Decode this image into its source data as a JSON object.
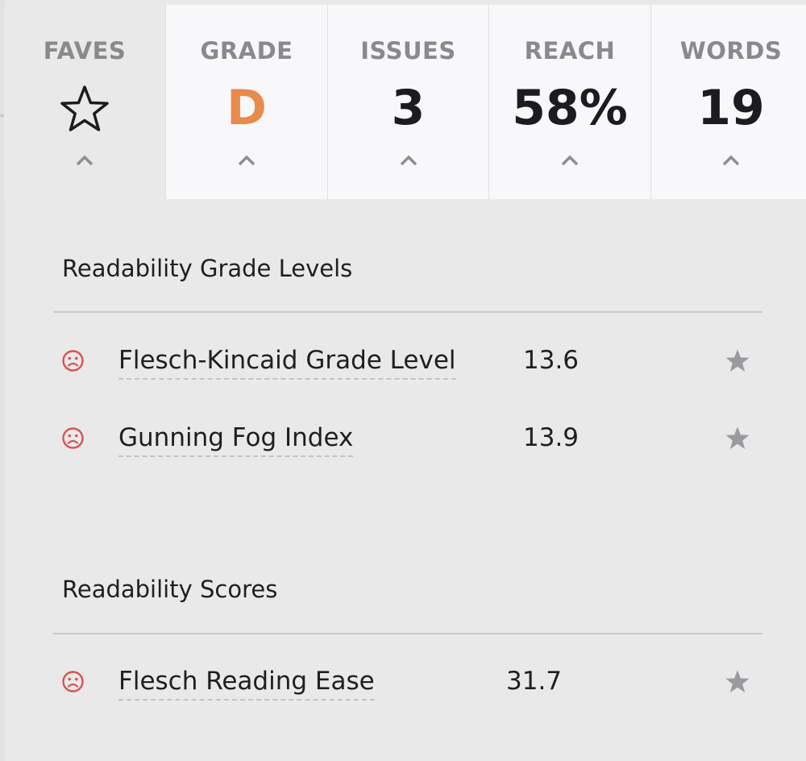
{
  "tabs": [
    {
      "label": "FAVES",
      "icon": "star-outline-icon"
    },
    {
      "label": "GRADE",
      "value": "D"
    },
    {
      "label": "ISSUES",
      "value": "3"
    },
    {
      "label": "REACH",
      "value": "58%"
    },
    {
      "label": "WORDS",
      "value": "19"
    }
  ],
  "sections": {
    "grade_levels": {
      "title": "Readability Grade Levels",
      "rows": [
        {
          "name": "Flesch-Kincaid Grade Level",
          "value": "13.6",
          "status_icon": "sad-face-icon"
        },
        {
          "name": "Gunning Fog Index",
          "value": "13.9",
          "status_icon": "sad-face-icon"
        }
      ]
    },
    "scores": {
      "title": "Readability Scores",
      "rows": [
        {
          "name": "Flesch Reading Ease",
          "value": "31.7",
          "status_icon": "sad-face-icon"
        }
      ]
    }
  },
  "colors": {
    "grade_accent": "#e88a4c",
    "status_bad": "#d9534f",
    "star_fill": "#9a9a9e",
    "panel_bg": "#e9e9ea",
    "tab_bg": "#f8f8fa"
  }
}
